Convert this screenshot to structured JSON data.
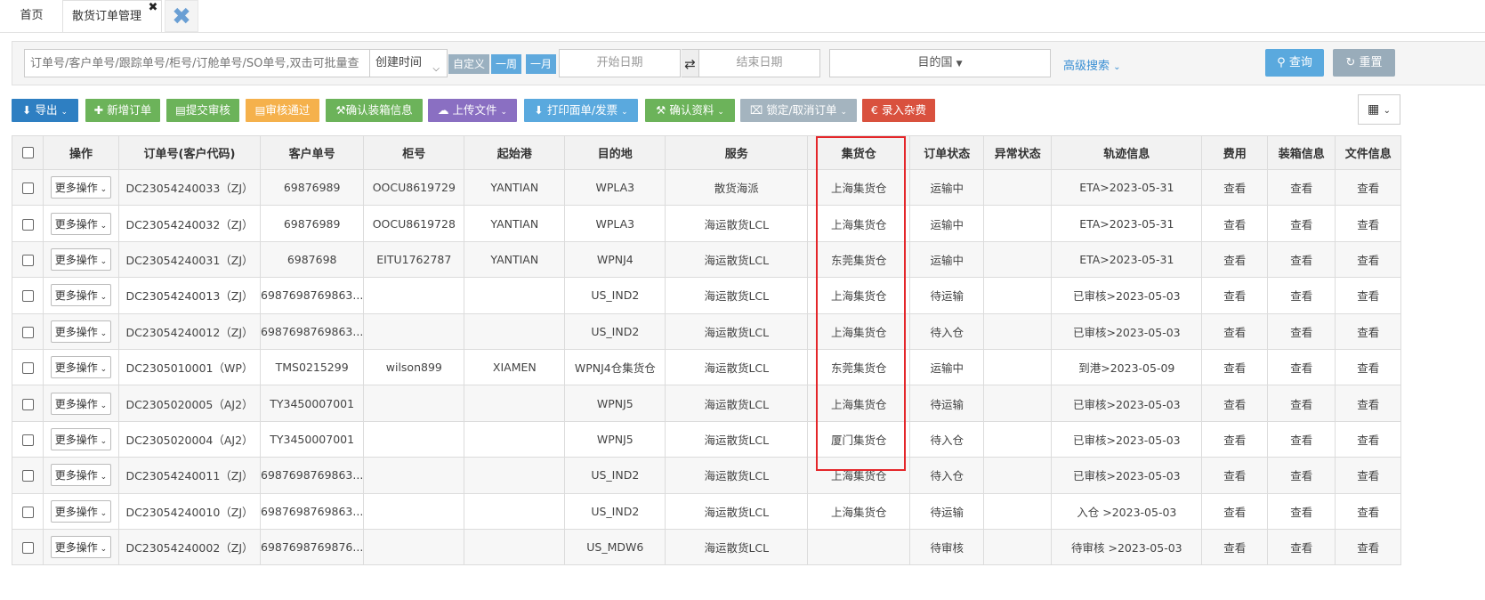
{
  "tabs": {
    "home": "首页",
    "active": "散货订单管理",
    "active_close": "✖",
    "close_all": "✖"
  },
  "search": {
    "order_placeholder": "订单号/客户单号/跟踪单号/柜号/订舱单号/SO单号,双击可批量查",
    "date_type": "创建时间",
    "custom": "自定义",
    "week": "一周",
    "month": "一月",
    "start_placeholder": "开始日期",
    "swap_icon": "⇄",
    "end_placeholder": "结束日期",
    "destination": "目的国",
    "advanced": "高级搜索",
    "query": "查询",
    "reset": "重置"
  },
  "toolbar": {
    "export": "导出",
    "new_order": "新增订单",
    "submit_review": "提交审核",
    "approve": "审核通过",
    "confirm_packing": "确认装箱信息",
    "upload": "上传文件",
    "print": "打印面单/发票",
    "confirm_docs": "确认资料",
    "lock": "锁定/取消订单",
    "fee": "€ 录入杂费"
  },
  "table": {
    "headers": [
      "操作",
      "订单号(客户代码)",
      "客户单号",
      "柜号",
      "起始港",
      "目的地",
      "服务",
      "集货仓",
      "订单状态",
      "异常状态",
      "轨迹信息",
      "费用",
      "装箱信息",
      "文件信息"
    ],
    "more_label": "更多操作",
    "view_label": "查看",
    "rows": [
      {
        "order": "DC23054240033（ZJ）",
        "cust": "69876989",
        "container": "OOCU8619729",
        "port": "YANTIAN",
        "dest": "WPLA3",
        "service": "散货海派",
        "warehouse": "上海集货仓",
        "status": "运输中",
        "exception": "",
        "track": "ETA>2023-05-31"
      },
      {
        "order": "DC23054240032（ZJ）",
        "cust": "69876989",
        "container": "OOCU8619728",
        "port": "YANTIAN",
        "dest": "WPLA3",
        "service": "海运散货LCL",
        "warehouse": "上海集货仓",
        "status": "运输中",
        "exception": "",
        "track": "ETA>2023-05-31"
      },
      {
        "order": "DC23054240031（ZJ）",
        "cust": "6987698",
        "container": "EITU1762787",
        "port": "YANTIAN",
        "dest": "WPNJ4",
        "service": "海运散货LCL",
        "warehouse": "东莞集货仓",
        "status": "运输中",
        "exception": "",
        "track": "ETA>2023-05-31"
      },
      {
        "order": "DC23054240013（ZJ）",
        "cust": "6987698769863...",
        "container": "",
        "port": "",
        "dest": "US_IND2",
        "service": "海运散货LCL",
        "warehouse": "上海集货仓",
        "status": "待运输",
        "exception": "",
        "track": "已审核>2023-05-03"
      },
      {
        "order": "DC23054240012（ZJ）",
        "cust": "6987698769863...",
        "container": "",
        "port": "",
        "dest": "US_IND2",
        "service": "海运散货LCL",
        "warehouse": "上海集货仓",
        "status": "待入仓",
        "exception": "",
        "track": "已审核>2023-05-03"
      },
      {
        "order": "DC2305010001（WP）",
        "cust": "TMS0215299",
        "container": "wilson899",
        "port": "XIAMEN",
        "dest": "WPNJ4仓集货仓",
        "service": "海运散货LCL",
        "warehouse": "东莞集货仓",
        "status": "运输中",
        "exception": "",
        "track": "到港>2023-05-09"
      },
      {
        "order": "DC2305020005（AJ2）",
        "cust": "TY3450007001",
        "container": "",
        "port": "",
        "dest": "WPNJ5",
        "service": "海运散货LCL",
        "warehouse": "上海集货仓",
        "status": "待运输",
        "exception": "",
        "track": "已审核>2023-05-03"
      },
      {
        "order": "DC2305020004（AJ2）",
        "cust": "TY3450007001",
        "container": "",
        "port": "",
        "dest": "WPNJ5",
        "service": "海运散货LCL",
        "warehouse": "厦门集货仓",
        "status": "待入仓",
        "exception": "",
        "track": "已审核>2023-05-03"
      },
      {
        "order": "DC23054240011（ZJ）",
        "cust": "6987698769863...",
        "container": "",
        "port": "",
        "dest": "US_IND2",
        "service": "海运散货LCL",
        "warehouse": "上海集货仓",
        "status": "待入仓",
        "exception": "",
        "track": "已审核>2023-05-03"
      },
      {
        "order": "DC23054240010（ZJ）",
        "cust": "6987698769863...",
        "container": "",
        "port": "",
        "dest": "US_IND2",
        "service": "海运散货LCL",
        "warehouse": "上海集货仓",
        "status": "待运输",
        "exception": "",
        "track": "入仓 >2023-05-03"
      },
      {
        "order": "DC23054240002（ZJ）",
        "cust": "6987698769876...",
        "container": "",
        "port": "",
        "dest": "US_MDW6",
        "service": "海运散货LCL",
        "warehouse": "",
        "status": "待审核",
        "exception": "",
        "track": "待审核 >2023-05-03"
      }
    ]
  },
  "colors": {
    "link": "#3a8fd4",
    "highlight": "#e4262a"
  }
}
